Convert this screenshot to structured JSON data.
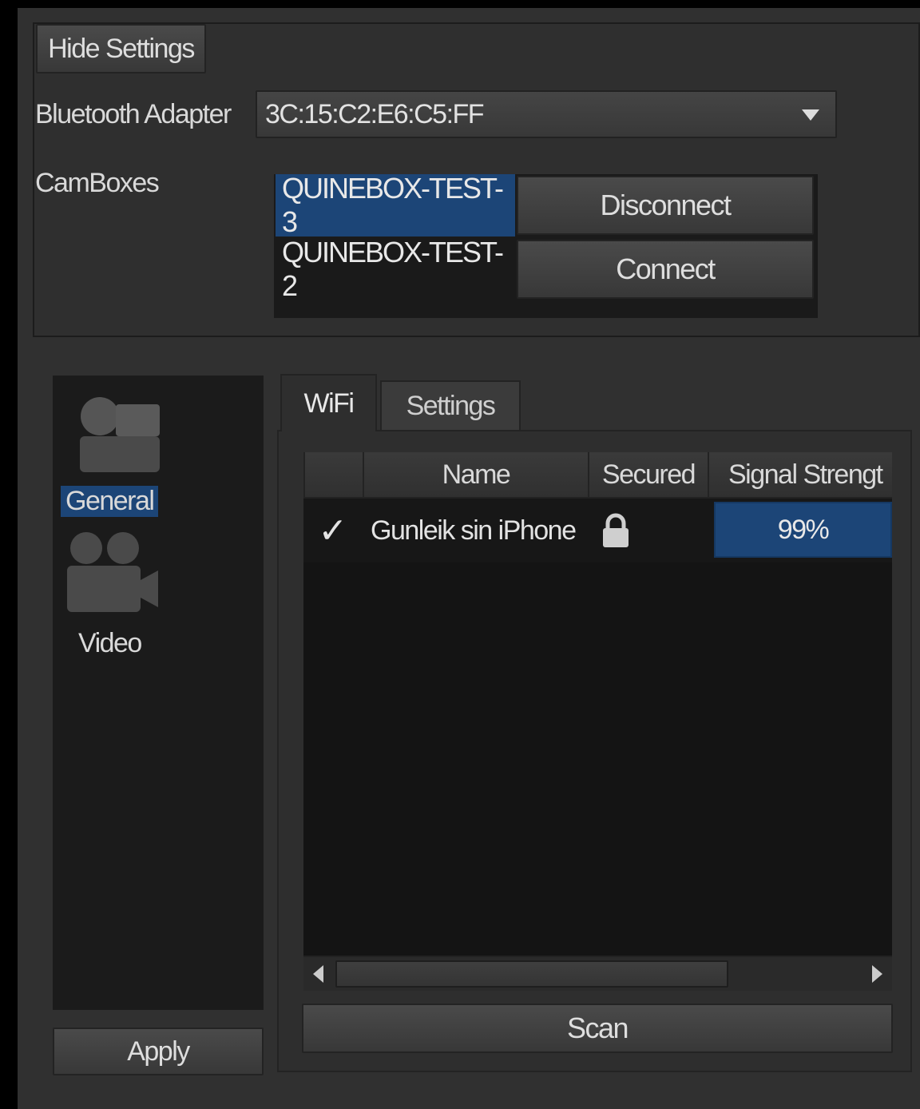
{
  "top": {
    "hide_settings_label": "Hide Settings",
    "adapter_label": "Bluetooth Adapter",
    "adapter_value": "3C:15:C2:E6:C5:FF",
    "camboxes_label": "CamBoxes",
    "camboxes": [
      {
        "name": "QUINEBOX-TEST-3",
        "action": "Disconnect",
        "selected": true
      },
      {
        "name": "QUINEBOX-TEST-2",
        "action": "Connect",
        "selected": false
      }
    ]
  },
  "sidebar": {
    "items": [
      {
        "label": "General",
        "icon": "general-icon",
        "selected": true
      },
      {
        "label": "Video",
        "icon": "video-camera-icon",
        "selected": false
      }
    ],
    "apply_label": "Apply"
  },
  "tabs": [
    {
      "label": "WiFi",
      "active": true
    },
    {
      "label": "Settings",
      "active": false
    }
  ],
  "wifi_table": {
    "columns": [
      "",
      "Name",
      "Secured",
      "Signal Strengt"
    ],
    "rows": [
      {
        "connected": "✓",
        "name": "Gunleik sin iPhone",
        "secured_icon": "lock-icon",
        "signal": "99%"
      }
    ]
  },
  "scan_label": "Scan",
  "colors": {
    "selection": "#1c4577",
    "background": "#303030",
    "panel": "#1b1b1b"
  }
}
